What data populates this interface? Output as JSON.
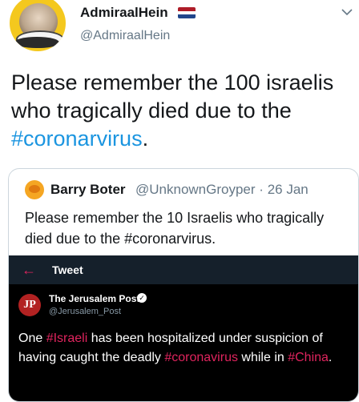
{
  "author": {
    "display_name": "AdmiraalHein",
    "handle": "@AdmiraalHein",
    "flag_colors": [
      "#ae1c28",
      "#ffffff",
      "#21468b"
    ]
  },
  "tweet": {
    "text_before": "Please remember the 100 israelis who tragically died due to the ",
    "hashtag": "#coronarvirus",
    "text_after": "."
  },
  "quoted": {
    "display_name": "Barry Boter",
    "handle": "@UnknownGroyper",
    "separator": "·",
    "date": "26 Jan",
    "text": "Please remember the 10 Israelis who tragically died due to the #coronarvirus."
  },
  "embedded": {
    "back_icon": "back-arrow-icon",
    "header_title": "Tweet",
    "account_name": "The Jerusalem Post",
    "account_handle": "@Jerusalem_Post",
    "logo_text": "JP",
    "body": {
      "part1": "One ",
      "tag1": "#Israeli",
      "part2": " has been hospitalized under suspicion of having caught the deadly ",
      "tag2": "#coronavirus",
      "part3": " while in ",
      "tag3": "#China",
      "part4": "."
    }
  },
  "colors": {
    "link_blue": "#1b95e0",
    "hashtag_pink": "#e0245e"
  }
}
